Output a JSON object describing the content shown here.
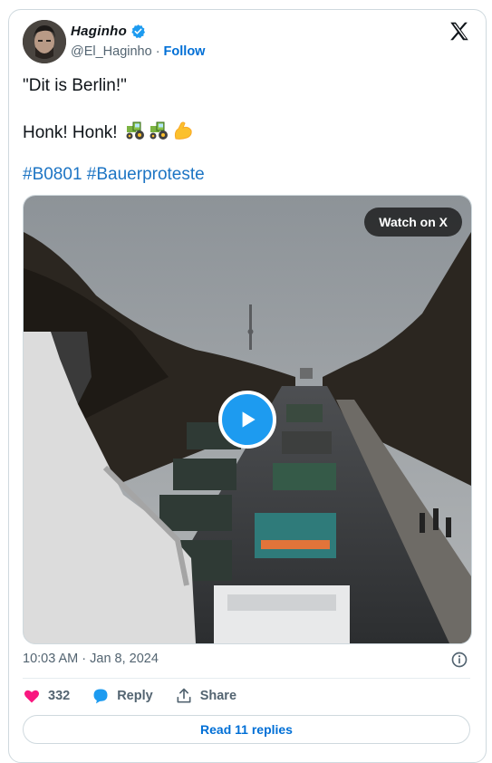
{
  "author": {
    "name": "Haginho",
    "handle": "@El_Haginho",
    "separator": "·",
    "follow_label": "Follow"
  },
  "tweet": {
    "line1": "\"Dit is Berlin!\"",
    "line2": "Honk! Honk!",
    "line2_emojis": [
      "tractor",
      "tractor",
      "flexed-biceps"
    ],
    "hashtags": [
      "#B0801",
      "#Bauerproteste"
    ]
  },
  "media": {
    "watch_label": "Watch on X"
  },
  "meta": {
    "timestamp": "10:03 AM · Jan 8, 2024"
  },
  "actions": {
    "likes": "332",
    "reply_label": "Reply",
    "share_label": "Share"
  },
  "replies_button": "Read 11 replies",
  "colors": {
    "link": "#1d75c4",
    "verified": "#1d9bf0",
    "like": "#f91880",
    "play": "#1d9bf0"
  }
}
